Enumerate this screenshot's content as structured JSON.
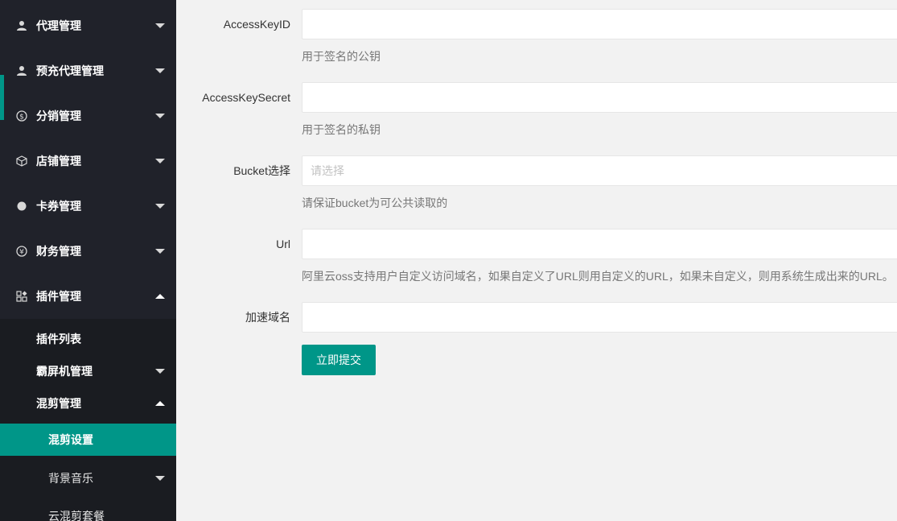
{
  "sidebar": {
    "items": [
      {
        "label": "代理管理",
        "icon": "user-icon"
      },
      {
        "label": "预充代理管理",
        "icon": "user-icon"
      },
      {
        "label": "分销管理",
        "icon": "dollar-circle-icon"
      },
      {
        "label": "店铺管理",
        "icon": "cube-icon"
      },
      {
        "label": "卡券管理",
        "icon": "circle-icon"
      },
      {
        "label": "财务管理",
        "icon": "yen-circle-icon"
      },
      {
        "label": "插件管理",
        "icon": "apps-icon"
      }
    ],
    "submenu": {
      "plugin_list": "插件列表",
      "screen_machine": "霸屏机管理",
      "mix_cut": "混剪管理",
      "mix_cut_settings": "混剪设置",
      "bg_music": "背景音乐",
      "cloud_package": "云混剪套餐"
    }
  },
  "form": {
    "access_key_id": {
      "label": "AccessKeyID",
      "value": "",
      "help": "用于签名的公钥"
    },
    "access_key_secret": {
      "label": "AccessKeySecret",
      "value": "",
      "help": "用于签名的私钥"
    },
    "bucket": {
      "label": "Bucket选择",
      "placeholder": "请选择",
      "help": "请保证bucket为可公共读取的"
    },
    "url": {
      "label": "Url",
      "value": "",
      "help": "阿里云oss支持用户自定义访问域名，如果自定义了URL则用自定义的URL，如果未自定义，则用系统生成出来的URL。"
    },
    "cdn_domain": {
      "label": "加速域名",
      "value": ""
    },
    "submit_label": "立即提交"
  },
  "colors": {
    "accent": "#009688",
    "sidebar_bg": "#20222a",
    "submenu_bg": "#1a1c21"
  }
}
